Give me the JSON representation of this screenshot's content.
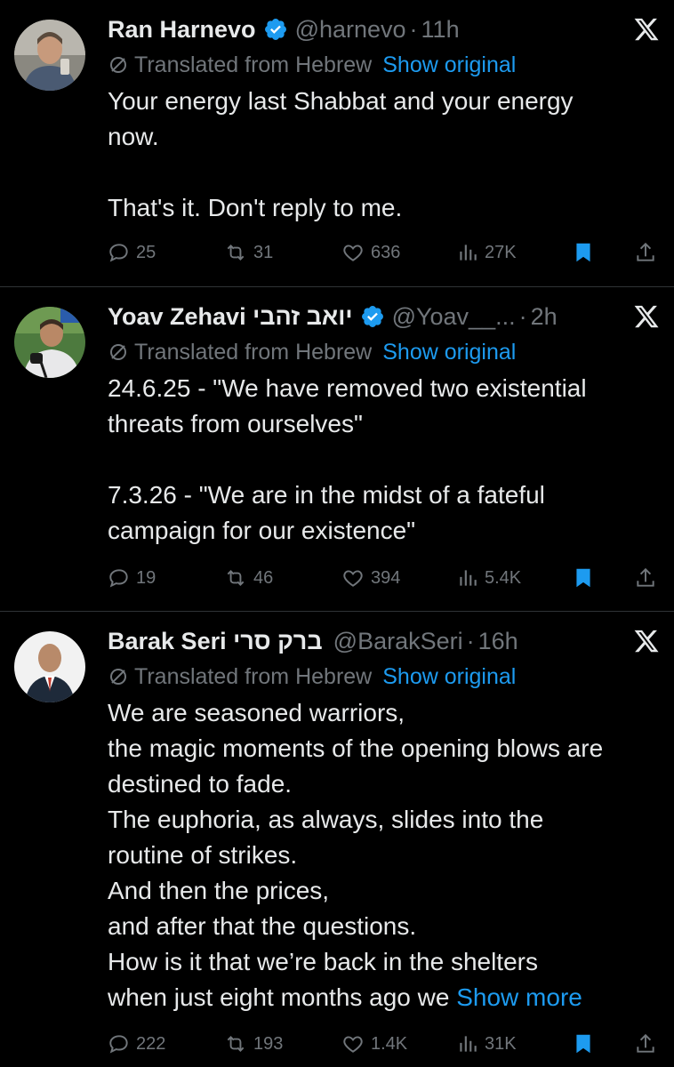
{
  "tweets": [
    {
      "name": "Ran Harnevo",
      "handle": "@harnevo",
      "time": "11h",
      "translated_label": "Translated from Hebrew",
      "show_original": "Show original",
      "text_lines": [
        "Your energy last Shabbat and your energy",
        "now.",
        "",
        "That's it. Don't reply to me."
      ],
      "show_more": "",
      "replies": "25",
      "reposts": "31",
      "likes": "636",
      "views": "27K"
    },
    {
      "name": "Yoav Zehavi יואב זהבי",
      "handle": "@Yoav__...",
      "time": "2h",
      "translated_label": "Translated from Hebrew",
      "show_original": "Show original",
      "text_lines": [
        "24.6.25 - \"We have removed two existential",
        "threats from ourselves\"",
        "",
        "7.3.26 - \"We are in the midst of a fateful",
        "campaign for our existence\""
      ],
      "show_more": "",
      "replies": "19",
      "reposts": "46",
      "likes": "394",
      "views": "5.4K"
    },
    {
      "name": "Barak Seri ברק סרי",
      "handle": "@BarakSeri",
      "time": "16h",
      "translated_label": "Translated from Hebrew",
      "show_original": "Show original",
      "text_lines": [
        "We are seasoned warriors,",
        "the magic moments of the opening blows are",
        "destined to fade.",
        "The euphoria, as always, slides into the",
        "routine of strikes.",
        "And then the prices,",
        "and after that the questions.",
        "How is it that we’re back in the shelters",
        "when just eight months ago we"
      ],
      "show_more": "Show more",
      "replies": "222",
      "reposts": "193",
      "likes": "1.4K",
      "views": "31K"
    }
  ],
  "separator": "·",
  "colors": {
    "background": "#000000",
    "text": "#e7e9ea",
    "secondary": "#71767b",
    "link": "#1d9bf0",
    "divider": "#2f3336"
  },
  "icons": [
    "verified-badge-icon",
    "x-logo-icon",
    "translate-icon",
    "reply-icon",
    "repost-icon",
    "like-icon",
    "views-icon",
    "bookmark-icon",
    "share-icon"
  ]
}
